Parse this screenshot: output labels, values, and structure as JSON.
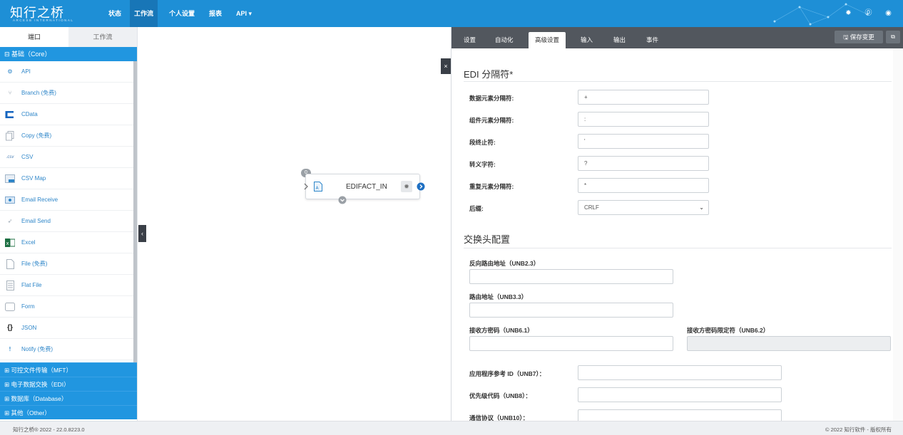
{
  "app": {
    "logo_text": "知行之桥",
    "logo_subtext": "ARCESB INTERNATIONAL"
  },
  "nav": {
    "items": [
      {
        "label": "状态"
      },
      {
        "label": "工作流"
      },
      {
        "label": "个人设置"
      },
      {
        "label": "报表"
      },
      {
        "label": "API ▾"
      }
    ],
    "active_index": 1
  },
  "left": {
    "tabs": [
      {
        "label": "端口"
      },
      {
        "label": "工作流"
      }
    ],
    "core_category": "⊟ 基础（Core）",
    "items": [
      {
        "label": "API",
        "icon": "api-icon"
      },
      {
        "label": "Branch (免费)",
        "icon": "branch-icon"
      },
      {
        "label": "CData",
        "icon": "cdata-icon"
      },
      {
        "label": "Copy (免费)",
        "icon": "copy-icon"
      },
      {
        "label": "CSV",
        "icon": "csv-icon"
      },
      {
        "label": "CSV Map",
        "icon": "csv-map-icon"
      },
      {
        "label": "Email Receive",
        "icon": "email-receive-icon"
      },
      {
        "label": "Email Send",
        "icon": "email-send-icon"
      },
      {
        "label": "Excel",
        "icon": "excel-icon"
      },
      {
        "label": "File (免费)",
        "icon": "file-icon"
      },
      {
        "label": "Flat File",
        "icon": "flat-file-icon"
      },
      {
        "label": "Form",
        "icon": "form-icon"
      },
      {
        "label": "JSON",
        "icon": "json-icon"
      },
      {
        "label": "Notify (免费)",
        "icon": "notify-icon"
      }
    ],
    "collapsed_categories": [
      {
        "label": "⊞ 可控文件传输（MFT）"
      },
      {
        "label": "⊞ 电子数据交换（EDI）"
      },
      {
        "label": "⊞ 数据库（Database）"
      },
      {
        "label": "⊞ 其他（Other）"
      }
    ]
  },
  "canvas": {
    "node_label": "EDIFACT_IN",
    "node_badge": "0"
  },
  "right": {
    "tabs": [
      {
        "label": "设置"
      },
      {
        "label": "自动化"
      },
      {
        "label": "高级设置"
      },
      {
        "label": "输入"
      },
      {
        "label": "输出"
      },
      {
        "label": "事件"
      }
    ],
    "active_tab_index": 2,
    "save_label": "🖫 保存变更",
    "edi_section_title": "EDI 分隔符*",
    "edi_fields": [
      {
        "label": "数据元素分隔符:",
        "value": "+"
      },
      {
        "label": "组件元素分隔符:",
        "value": ":"
      },
      {
        "label": "段终止符:",
        "value": "'"
      },
      {
        "label": "转义字符:",
        "value": "?"
      },
      {
        "label": "重复元素分隔符:",
        "value": "*"
      },
      {
        "label": "后缀:",
        "value": "CRLF"
      }
    ],
    "interchange_section_title": "交换头配置",
    "unb_fields": [
      {
        "label": "反向路由地址（UNB2.3）",
        "value": ""
      },
      {
        "label": "路由地址（UNB3.3）",
        "value": ""
      },
      {
        "label": "接收方密码（UNB6.1）",
        "value": ""
      },
      {
        "label": "接收方密码限定符（UNB6.2）",
        "value": ""
      }
    ],
    "extra_fields": [
      {
        "label": "应用程序参考 ID（UNB7）：",
        "value": ""
      },
      {
        "label": "优先级代码（UNB8）：",
        "value": ""
      },
      {
        "label": "通信协议（UNB10）：",
        "value": ""
      }
    ]
  },
  "footer": {
    "left": "知行之桥® 2022 - 22.0.8223.0",
    "right": "© 2022 知行软件 - 版权所有"
  },
  "colors": {
    "brand_blue": "#1e8fd6",
    "category_blue": "#2196e0",
    "tab_bar_gray": "#52575e",
    "link_blue": "#2e86c9"
  }
}
